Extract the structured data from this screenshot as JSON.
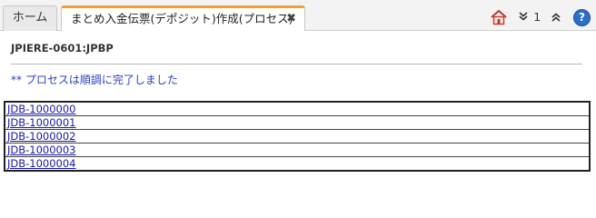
{
  "tabs": {
    "home_label": "ホーム",
    "active_label": "まとめ入金伝票(デポジット)作成(プロセス)",
    "close_glyph": "✖"
  },
  "toolbar": {
    "home_icon": "home-icon",
    "collapse_label": "1",
    "collapse_icon": "double-chevron-down-icon",
    "expand_icon": "double-chevron-up-icon",
    "help_icon": "help-icon",
    "help_glyph": "?"
  },
  "main": {
    "process_title": "JPIERE-0601:JPBP",
    "status_message": "** プロセスは順調に完了しました",
    "documents": [
      "JDB-1000000",
      "JDB-1000001",
      "JDB-1000002",
      "JDB-1000003",
      "JDB-1000004"
    ]
  },
  "colors": {
    "active_tab_accent": "#f0a030",
    "status_text": "#2b3fbf",
    "link": "#1a1aa6",
    "help_icon_bg": "#2a6fc9",
    "home_icon_red": "#c0392b"
  }
}
